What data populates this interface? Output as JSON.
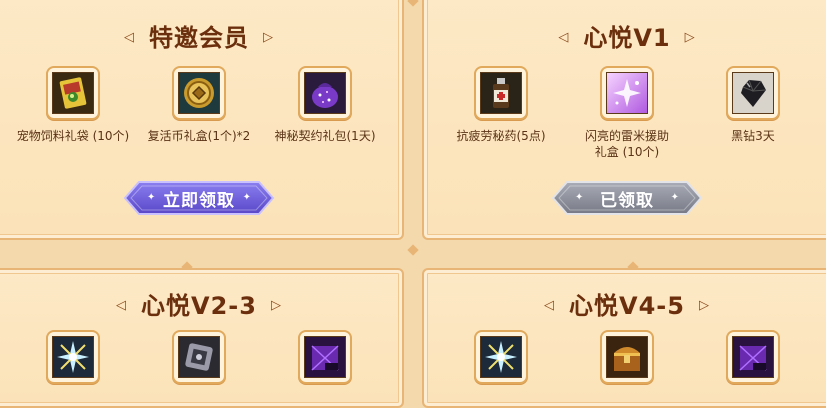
{
  "panels": [
    {
      "title": "特邀会员",
      "items": [
        {
          "name": "宠物饲料礼袋 (10个)",
          "icon": "pet-feed-bag-icon"
        },
        {
          "name": "复活币礼盒(1个)*2",
          "icon": "revive-coin-box-icon"
        },
        {
          "name": "神秘契约礼包(1天)",
          "icon": "mystery-contract-bag-icon"
        }
      ],
      "button": {
        "label": "立即领取",
        "state": "available"
      }
    },
    {
      "title": "心悦V1",
      "items": [
        {
          "name": "抗疲劳秘药(5点)",
          "icon": "anti-fatigue-potion-icon"
        },
        {
          "name": "闪亮的雷米援助\n礼盒 (10个)",
          "icon": "shiny-remy-box-icon"
        },
        {
          "name": "黑钻3天",
          "icon": "black-diamond-icon"
        }
      ],
      "button": {
        "label": "已领取",
        "state": "claimed"
      }
    },
    {
      "title": "心悦V2-3",
      "items": [
        {
          "icon": "crystal-burst-icon"
        },
        {
          "icon": "silver-box-icon"
        },
        {
          "icon": "purple-pack-icon"
        }
      ]
    },
    {
      "title": "心悦V4-5",
      "items": [
        {
          "icon": "crystal-burst-icon"
        },
        {
          "icon": "golden-chest-icon"
        },
        {
          "icon": "purple-pack-icon"
        }
      ]
    }
  ],
  "colors": {
    "panel_bg": "#fde9c6",
    "border": "#e8b577",
    "title": "#6b2f0d",
    "button_available": "#6a5ad6",
    "button_claimed": "#8a8e9c"
  }
}
